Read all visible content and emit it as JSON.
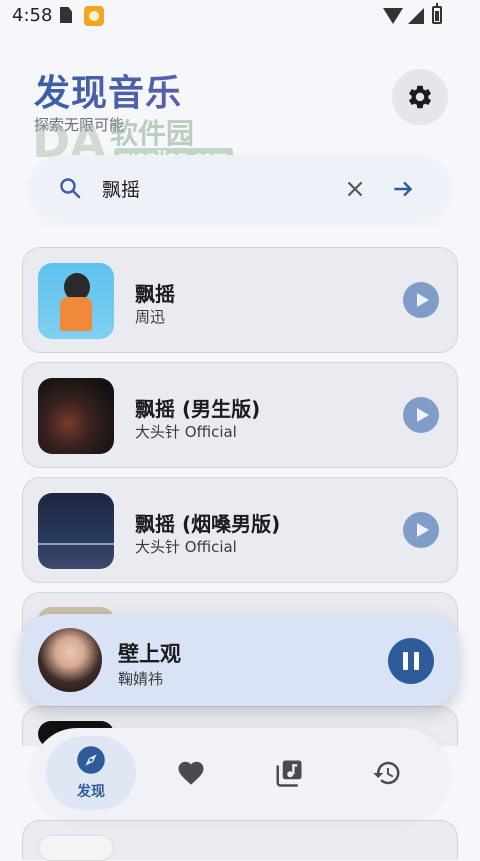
{
  "status_bar": {
    "time": "4:58"
  },
  "header": {
    "title": "发现音乐",
    "subtitle": "探索无限可能"
  },
  "watermark": {
    "text": "软件园",
    "url": "ruanjian.com",
    "logo": "DA"
  },
  "search": {
    "query": "飘摇"
  },
  "songs": [
    {
      "title": "飘摇",
      "artist": "周迅"
    },
    {
      "title": "飘摇 (男生版)",
      "artist": "大头针 Official"
    },
    {
      "title": "飘摇 (烟嗓男版)",
      "artist": "大头针 Official"
    }
  ],
  "now_playing": {
    "title": "壁上观",
    "artist": "鞠婧祎"
  },
  "nav": {
    "items": [
      {
        "label": "发现",
        "active": true
      }
    ]
  },
  "colors": {
    "accent": "#2e5c9a",
    "play_button": "#7f9dc8",
    "card_bg": "#e9ebf1"
  },
  "icons": [
    "gear-icon",
    "search-icon",
    "close-icon",
    "arrow-right-icon",
    "play-icon",
    "pause-icon",
    "compass-icon",
    "heart-icon",
    "music-library-icon",
    "history-icon"
  ]
}
